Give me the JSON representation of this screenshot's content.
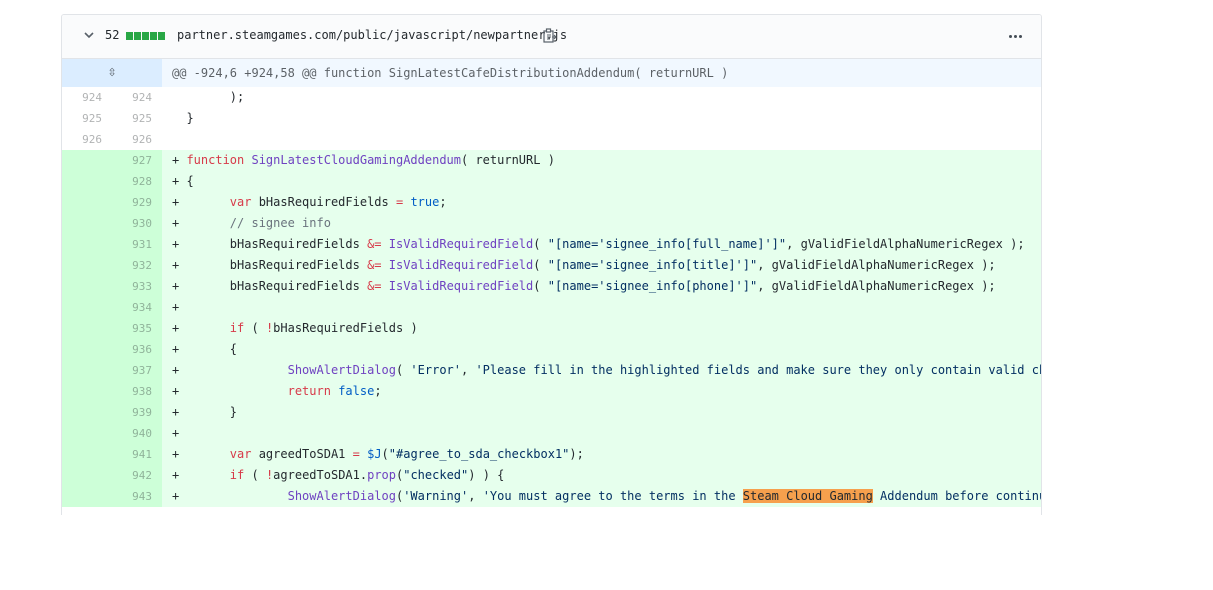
{
  "file": {
    "diffstat_count": "52",
    "diffstat_blocks": 5,
    "path": "partner.steamgames.com/public/javascript/newpartner.js",
    "expand_icon": "unfold-icon",
    "copy_icon": "clipboard-icon",
    "more_icon": "kebab-horizontal-icon",
    "chevron_icon": "chevron-down-icon"
  },
  "hunk": {
    "expand_symbol": "⇳",
    "header": "@@ -924,6 +924,58 @@ function SignLatestCafeDistributionAddendum( returnURL )"
  },
  "lines": [
    {
      "type": "ctx",
      "old": "924",
      "new": "924",
      "text": "        );"
    },
    {
      "type": "ctx",
      "old": "925",
      "new": "925",
      "text": "  }"
    },
    {
      "type": "ctx",
      "old": "926",
      "new": "926",
      "text": ""
    },
    {
      "type": "add",
      "old": "",
      "new": "927",
      "text": "+ function SignLatestCloudGamingAddendum( returnURL )"
    },
    {
      "type": "add",
      "old": "",
      "new": "928",
      "text": "+ {"
    },
    {
      "type": "add",
      "old": "",
      "new": "929",
      "text": "+       var bHasRequiredFields = true;"
    },
    {
      "type": "add",
      "old": "",
      "new": "930",
      "text": "+       // signee info"
    },
    {
      "type": "add",
      "old": "",
      "new": "931",
      "text": "+       bHasRequiredFields &= IsValidRequiredField( \"[name='signee_info[full_name]']\", gValidFieldAlphaNumericRegex );"
    },
    {
      "type": "add",
      "old": "",
      "new": "932",
      "text": "+       bHasRequiredFields &= IsValidRequiredField( \"[name='signee_info[title]']\", gValidFieldAlphaNumericRegex );"
    },
    {
      "type": "add",
      "old": "",
      "new": "933",
      "text": "+       bHasRequiredFields &= IsValidRequiredField( \"[name='signee_info[phone]']\", gValidFieldAlphaNumericRegex );"
    },
    {
      "type": "add",
      "old": "",
      "new": "934",
      "text": "+"
    },
    {
      "type": "add",
      "old": "",
      "new": "935",
      "text": "+       if ( !bHasRequiredFields )"
    },
    {
      "type": "add",
      "old": "",
      "new": "936",
      "text": "+       {"
    },
    {
      "type": "add",
      "old": "",
      "new": "937",
      "text": "+               ShowAlertDialog( 'Error', 'Please fill in the highlighted fields and make sure they only contain valid characters: a"
    },
    {
      "type": "add",
      "old": "",
      "new": "938",
      "text": "+               return false;"
    },
    {
      "type": "add",
      "old": "",
      "new": "939",
      "text": "+       }"
    },
    {
      "type": "add",
      "old": "",
      "new": "940",
      "text": "+"
    },
    {
      "type": "add",
      "old": "",
      "new": "941",
      "text": "+       var agreedToSDA1 = $J(\"#agree_to_sda_checkbox1\");"
    },
    {
      "type": "add",
      "old": "",
      "new": "942",
      "text": "+       if ( !agreedToSDA1.prop(\"checked\") ) {"
    },
    {
      "type": "add",
      "old": "",
      "new": "943",
      "text": "+               ShowAlertDialog('Warning', 'You must agree to the terms in the Steam Cloud Gaming Addendum before continuing.');"
    }
  ],
  "highlight": {
    "line": "943",
    "text": "Steam Cloud Gaming",
    "color": "#f6a04d"
  },
  "colors": {
    "addition_bg": "#e6ffed",
    "addition_gutter": "#cdffd8",
    "hunk_bg": "#f1f8ff",
    "hunk_expand_bg": "#dbedff",
    "diffstat": "#28a745"
  }
}
